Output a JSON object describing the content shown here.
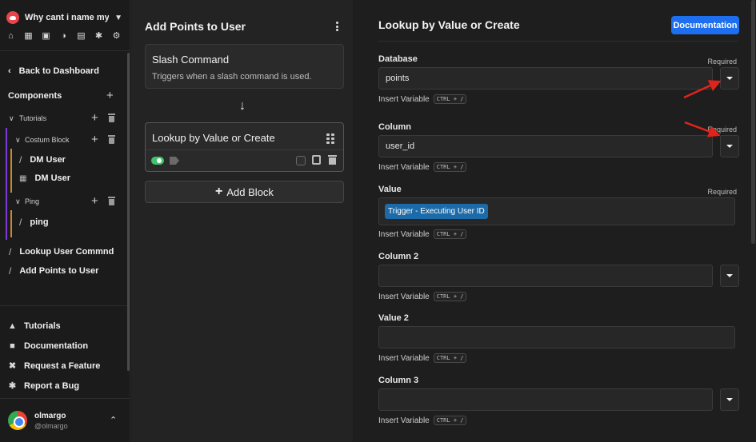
{
  "sidebar": {
    "server_name": "Why cant i name my...",
    "top_icons": [
      "home-icon",
      "library-icon",
      "database-icon",
      "globe-icon",
      "layout-icon",
      "bug-icon",
      "gear-icon"
    ],
    "back_label": "Back to Dashboard",
    "components_title": "Components",
    "tree": {
      "tutorials": "Tutorials",
      "costum_block": "Costum Block",
      "dm_user_1": "DM User",
      "dm_user_2": "DM User",
      "ping_group": "Ping",
      "ping": "ping",
      "lookup": "Lookup User Commnd",
      "add_points": "Add Points to User"
    },
    "bottom": {
      "tutorials": "Tutorials",
      "documentation": "Documentation",
      "request": "Request a Feature",
      "bug": "Report a Bug"
    },
    "user": {
      "name": "olmargo",
      "handle": "@olmargo"
    }
  },
  "middle": {
    "title": "Add Points to User",
    "trigger": {
      "title": "Slash Command",
      "subtitle": "Triggers when a slash command is used."
    },
    "block": {
      "title": "Lookup by Value or Create",
      "enabled": true
    },
    "add_block_label": "Add Block"
  },
  "right": {
    "title": "Lookup by Value or Create",
    "doc_button": "Documentation",
    "required": "Required",
    "insert_variable": "Insert Variable",
    "shortcut": "CTRL + /",
    "fields": {
      "database": {
        "label": "Database",
        "value": "points"
      },
      "column": {
        "label": "Column",
        "value": "user_id"
      },
      "value": {
        "label": "Value",
        "chip": "Trigger - Executing User ID"
      },
      "column2": {
        "label": "Column 2",
        "value": ""
      },
      "value2": {
        "label": "Value 2",
        "value": ""
      },
      "column3": {
        "label": "Column 3",
        "value": ""
      }
    }
  },
  "colors": {
    "accent": "#1d6ff0",
    "toggle_on": "#3ec46d",
    "chip": "#1c6ba8",
    "annotation_arrow": "#e0241b"
  }
}
